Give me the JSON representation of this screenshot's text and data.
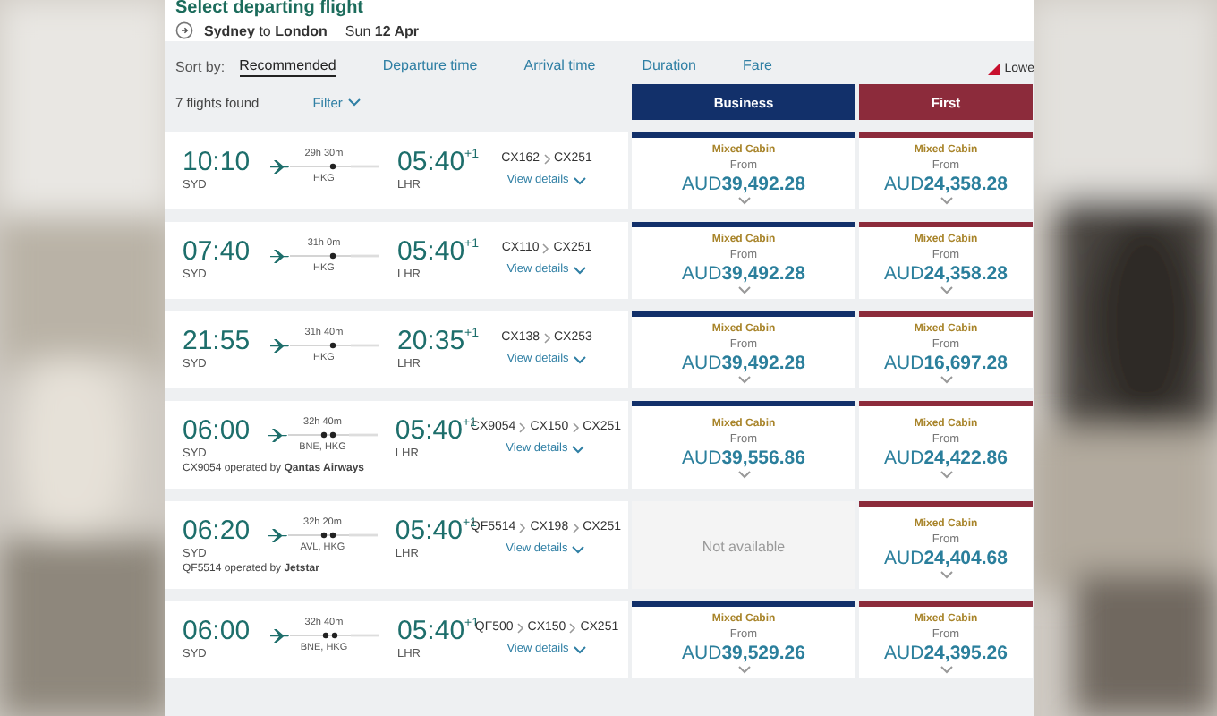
{
  "header": {
    "title": "Select departing flight",
    "route": "**Sydney** to **London**",
    "date": "Sun **12 Apr**"
  },
  "sort": {
    "label": "Sort by:",
    "options": [
      {
        "label": "Recommended",
        "selected": true
      },
      {
        "label": "Departure time",
        "selected": false
      },
      {
        "label": "Arrival time",
        "selected": false
      },
      {
        "label": "Duration",
        "selected": false
      },
      {
        "label": "Fare",
        "selected": false
      }
    ]
  },
  "legend": {
    "text": "Lowe"
  },
  "results": {
    "count": "7 flights found",
    "filter": "Filter"
  },
  "cabins": [
    {
      "label": "Business",
      "color": "#12306a"
    },
    {
      "label": "First",
      "color": "#8c2b3b"
    }
  ],
  "flights": [
    {
      "kind": "one-stop",
      "depart": "10:10",
      "from": "SYD",
      "duration": "29h 30m",
      "stops": "HKG",
      "arrive": "05:40",
      "day_offset": "+1",
      "to": "LHR",
      "flight_numbers": [
        "CX162",
        "CX251"
      ],
      "details": "View details",
      "fares": [
        {
          "kind": "fare",
          "label": "Mixed Cabin",
          "from": "From",
          "price": "AUD**39,492.28**"
        },
        {
          "kind": "fare",
          "label": "Mixed Cabin",
          "from": "From",
          "price": "AUD**24,358.28**"
        }
      ]
    },
    {
      "kind": "one-stop",
      "depart": "07:40",
      "from": "SYD",
      "duration": "31h 0m",
      "stops": "HKG",
      "arrive": "05:40",
      "day_offset": "+1",
      "to": "LHR",
      "flight_numbers": [
        "CX110",
        "CX251"
      ],
      "details": "View details",
      "fares": [
        {
          "kind": "fare",
          "label": "Mixed Cabin",
          "from": "From",
          "price": "AUD**39,492.28**"
        },
        {
          "kind": "fare",
          "label": "Mixed Cabin",
          "from": "From",
          "price": "AUD**24,358.28**"
        }
      ]
    },
    {
      "kind": "one-stop",
      "depart": "21:55",
      "from": "SYD",
      "duration": "31h 40m",
      "stops": "HKG",
      "arrive": "20:35",
      "day_offset": "+1",
      "to": "LHR",
      "flight_numbers": [
        "CX138",
        "CX253"
      ],
      "details": "View details",
      "fares": [
        {
          "kind": "fare",
          "label": "Mixed Cabin",
          "from": "From",
          "price": "AUD**39,492.28**"
        },
        {
          "kind": "fare",
          "label": "Mixed Cabin",
          "from": "From",
          "price": "AUD**16,697.28**"
        }
      ]
    },
    {
      "kind": "two-stop",
      "depart": "06:00",
      "from": "SYD",
      "duration": "32h 40m",
      "stops": "BNE, HKG",
      "arrive": "05:40",
      "day_offset": "+1",
      "to": "LHR",
      "flight_numbers": [
        "CX9054",
        "CX150",
        "CX251"
      ],
      "details": "View details",
      "operated": "CX9054 operated by **Qantas Airways**",
      "fares": [
        {
          "kind": "fare",
          "label": "Mixed Cabin",
          "from": "From",
          "price": "AUD**39,556.86**"
        },
        {
          "kind": "fare",
          "label": "Mixed Cabin",
          "from": "From",
          "price": "AUD**24,422.86**"
        }
      ]
    },
    {
      "kind": "two-stop",
      "depart": "06:20",
      "from": "SYD",
      "duration": "32h 20m",
      "stops": "AVL, HKG",
      "arrive": "05:40",
      "day_offset": "+1",
      "to": "LHR",
      "flight_numbers": [
        "QF5514",
        "CX198",
        "CX251"
      ],
      "details": "View details",
      "operated": "QF5514 operated by **Jetstar**",
      "fares": [
        {
          "kind": "unavailable",
          "text": "Not available"
        },
        {
          "kind": "fare",
          "label": "Mixed Cabin",
          "from": "From",
          "price": "AUD**24,404.68**"
        }
      ]
    },
    {
      "kind": "two-stop",
      "depart": "06:00",
      "from": "SYD",
      "duration": "32h 40m",
      "stops": "BNE, HKG",
      "arrive": "05:40",
      "day_offset": "+1",
      "to": "LHR",
      "flight_numbers": [
        "QF500",
        "CX150",
        "CX251"
      ],
      "details": "View details",
      "fares": [
        {
          "kind": "fare",
          "label": "Mixed Cabin",
          "from": "From",
          "price": "AUD**39,529.26**"
        },
        {
          "kind": "fare",
          "label": "Mixed Cabin",
          "from": "From",
          "price": "AUD**24,395.26**"
        }
      ]
    }
  ]
}
